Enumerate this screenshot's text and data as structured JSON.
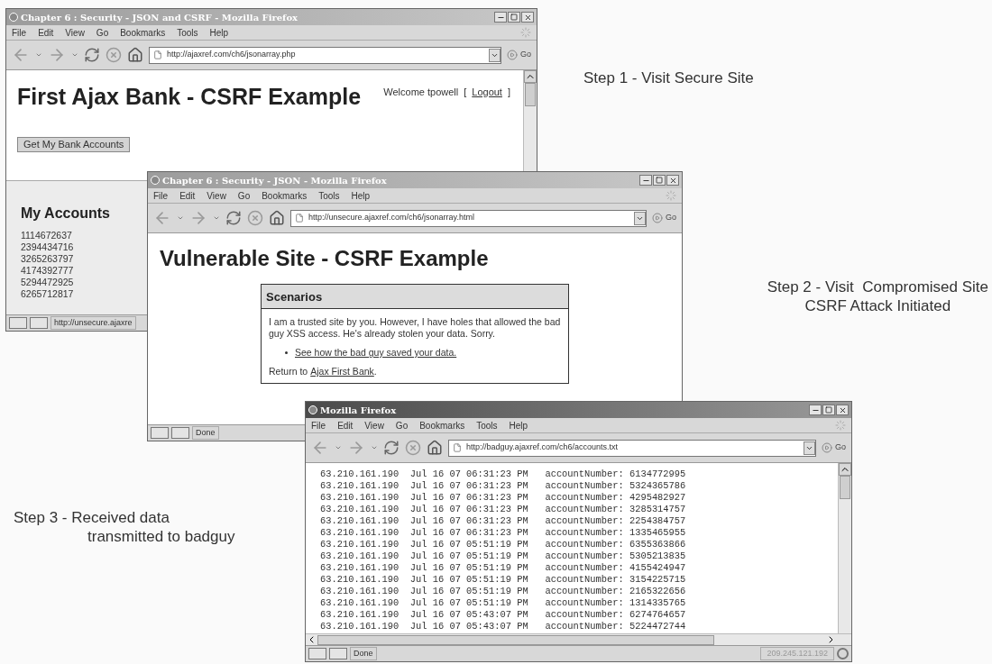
{
  "windows": [
    {
      "kind": "bank",
      "active": false,
      "title": "Chapter 6 : Security - JSON and CSRF - Mozilla Firefox",
      "menu": [
        "File",
        "Edit",
        "View",
        "Go",
        "Bookmarks",
        "Tools",
        "Help"
      ],
      "url": "http://ajaxref.com/ch6/jsonarray.php",
      "go": "Go",
      "page": {
        "heading": "First Ajax Bank - CSRF Example",
        "welcome": "Welcome tpowell",
        "logout_open": "[",
        "logout": "Logout",
        "logout_close": "]",
        "button": "Get My Bank Accounts",
        "accounts_title": "My Accounts",
        "accounts": [
          "1114672637",
          "2394434716",
          "3265263797",
          "4174392777",
          "5294472925",
          "6265712817"
        ]
      },
      "status": "http://unsecure.ajaxre"
    },
    {
      "kind": "vulnerable",
      "active": false,
      "title": "Chapter 6 : Security - JSON - Mozilla Firefox",
      "menu": [
        "File",
        "Edit",
        "View",
        "Go",
        "Bookmarks",
        "Tools",
        "Help"
      ],
      "url": "http://unsecure.ajaxref.com/ch6/jsonarray.html",
      "go": "Go",
      "page": {
        "heading": "Vulnerable Site - CSRF Example",
        "panel_title": "Scenarios",
        "panel_text": "I am a trusted site by you. However, I have holes that allowed the bad guy XSS access. He's already stolen your data. Sorry.",
        "panel_link": "See how the bad guy saved your data.",
        "return_text": "Return to",
        "return_link": "Ajax First Bank",
        "return_end": "."
      },
      "status": "Done"
    },
    {
      "kind": "log",
      "active": true,
      "title": "Mozilla Firefox",
      "menu": [
        "File",
        "Edit",
        "View",
        "Go",
        "Bookmarks",
        "Tools",
        "Help"
      ],
      "url": "http://badguy.ajaxref.com/ch6/accounts.txt",
      "go": "Go",
      "page": {
        "lines": [
          "63.210.161.190  Jul 16 07 06:31:23 PM   accountNumber: 6134772995",
          "63.210.161.190  Jul 16 07 06:31:23 PM   accountNumber: 5324365786",
          "63.210.161.190  Jul 16 07 06:31:23 PM   accountNumber: 4295482927",
          "63.210.161.190  Jul 16 07 06:31:23 PM   accountNumber: 3285314757",
          "63.210.161.190  Jul 16 07 06:31:23 PM   accountNumber: 2254384757",
          "63.210.161.190  Jul 16 07 06:31:23 PM   accountNumber: 1335465955",
          "63.210.161.190  Jul 16 07 05:51:19 PM   accountNumber: 6355363866",
          "63.210.161.190  Jul 16 07 05:51:19 PM   accountNumber: 5305213835",
          "63.210.161.190  Jul 16 07 05:51:19 PM   accountNumber: 4155424947",
          "63.210.161.190  Jul 16 07 05:51:19 PM   accountNumber: 3154225715",
          "63.210.161.190  Jul 16 07 05:51:19 PM   accountNumber: 2165322656",
          "63.210.161.190  Jul 16 07 05:51:19 PM   accountNumber: 1314335765",
          "63.210.161.190  Jul 16 07 05:43:07 PM   accountNumber: 6274764657",
          "63.210.161.190  Jul 16 07 05:43:07 PM   accountNumber: 5224472744"
        ]
      },
      "status": "Done",
      "status_ip": "209.245.121.192"
    }
  ],
  "captions": [
    {
      "lines": [
        "Step 1 - Visit Secure Site"
      ]
    },
    {
      "lines": [
        "Step 2 - Visit  Compromised Site",
        "CSRF Attack Initiated"
      ]
    },
    {
      "lines": [
        "Step 3 - Received data",
        "transmitted to badguy"
      ]
    }
  ]
}
